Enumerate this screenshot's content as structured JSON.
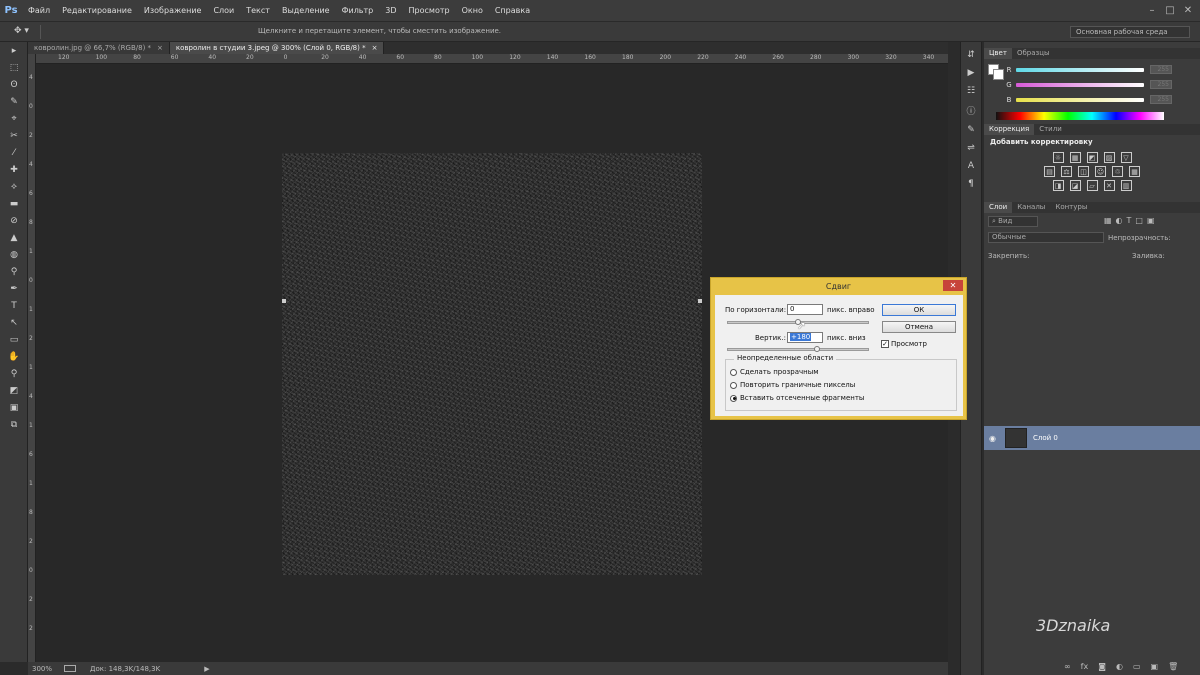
{
  "app": {
    "logo": "Ps"
  },
  "menu": [
    "Файл",
    "Редактирование",
    "Изображение",
    "Слои",
    "Текст",
    "Выделение",
    "Фильтр",
    "3D",
    "Просмотр",
    "Окно",
    "Справка"
  ],
  "optbar": {
    "hint": "Щелкните и перетащите элемент, чтобы сместить изображение.",
    "workspace": "Основная рабочая среда"
  },
  "tabs": [
    {
      "label": "ковролин.jpg @ 66,7% (RGB/8) *",
      "close": "×"
    },
    {
      "label": "ковролин в студии 3.jpeg @ 300% (Слой 0, RGB/8) *",
      "close": "×"
    }
  ],
  "ruler": {
    "h": [
      "120",
      "100",
      "80",
      "60",
      "40",
      "20",
      "0",
      "20",
      "40",
      "60",
      "80",
      "100",
      "120",
      "140",
      "160",
      "180",
      "200",
      "220",
      "240",
      "260",
      "280",
      "300",
      "320",
      "340"
    ],
    "v": [
      "4",
      "0",
      "2",
      "4",
      "6",
      "8",
      "1",
      "0",
      "1",
      "2",
      "1",
      "4",
      "1",
      "6",
      "1",
      "8",
      "2",
      "0",
      "2",
      "2"
    ]
  },
  "status": {
    "zoom": "300%",
    "doc": "Док: 148,3K/148,3K"
  },
  "colorPanel": {
    "tabs": [
      "Цвет",
      "Образцы"
    ],
    "channels": [
      {
        "label": "R",
        "value": "255",
        "gradient": "#5fd8e6"
      },
      {
        "label": "G",
        "value": "255",
        "gradient": "#d65ad6"
      },
      {
        "label": "B",
        "value": "255",
        "gradient": "#e6e04a"
      }
    ]
  },
  "adjustPanel": {
    "tabs": [
      "Коррекция",
      "Стили"
    ],
    "title": "Добавить корректировку",
    "row1": [
      "☼",
      "▦",
      "◩",
      "▨",
      "▽"
    ],
    "row2": [
      "▤",
      "⚖",
      "◫",
      "☺",
      "♲",
      "▦"
    ],
    "row3": [
      "◨",
      "◪",
      "▱",
      "✕",
      "▥"
    ]
  },
  "layersPanel": {
    "tabs": [
      "Слои",
      "Каналы",
      "Контуры"
    ],
    "filter": "Вид",
    "blend": "Обычные",
    "opacityLabel": "Непрозрачность:",
    "lockLabel": "Закрепить:",
    "fillLabel": "Заливка:",
    "layerName": "Слой 0",
    "footer": [
      "∞",
      "fx",
      "◙",
      "◐",
      "▭",
      "▣",
      "🗑"
    ]
  },
  "dialog": {
    "title": "Сдвиг",
    "close": "✕",
    "horizLabel": "По горизонтали:",
    "horizValue": "0",
    "horizUnit": "пикс. вправо",
    "vertLabel": "Вертик.:",
    "vertValue": "+180",
    "vertUnit": "пикс. вниз",
    "ok": "ОК",
    "cancel": "Отмена",
    "preview": "Просмотр",
    "groupTitle": "Неопределенные области",
    "options": [
      "Сделать прозрачным",
      "Повторить граничные пикселы",
      "Вставить отсеченные фрагменты"
    ],
    "selectedOption": 2
  },
  "watermark": "3Dznaika"
}
